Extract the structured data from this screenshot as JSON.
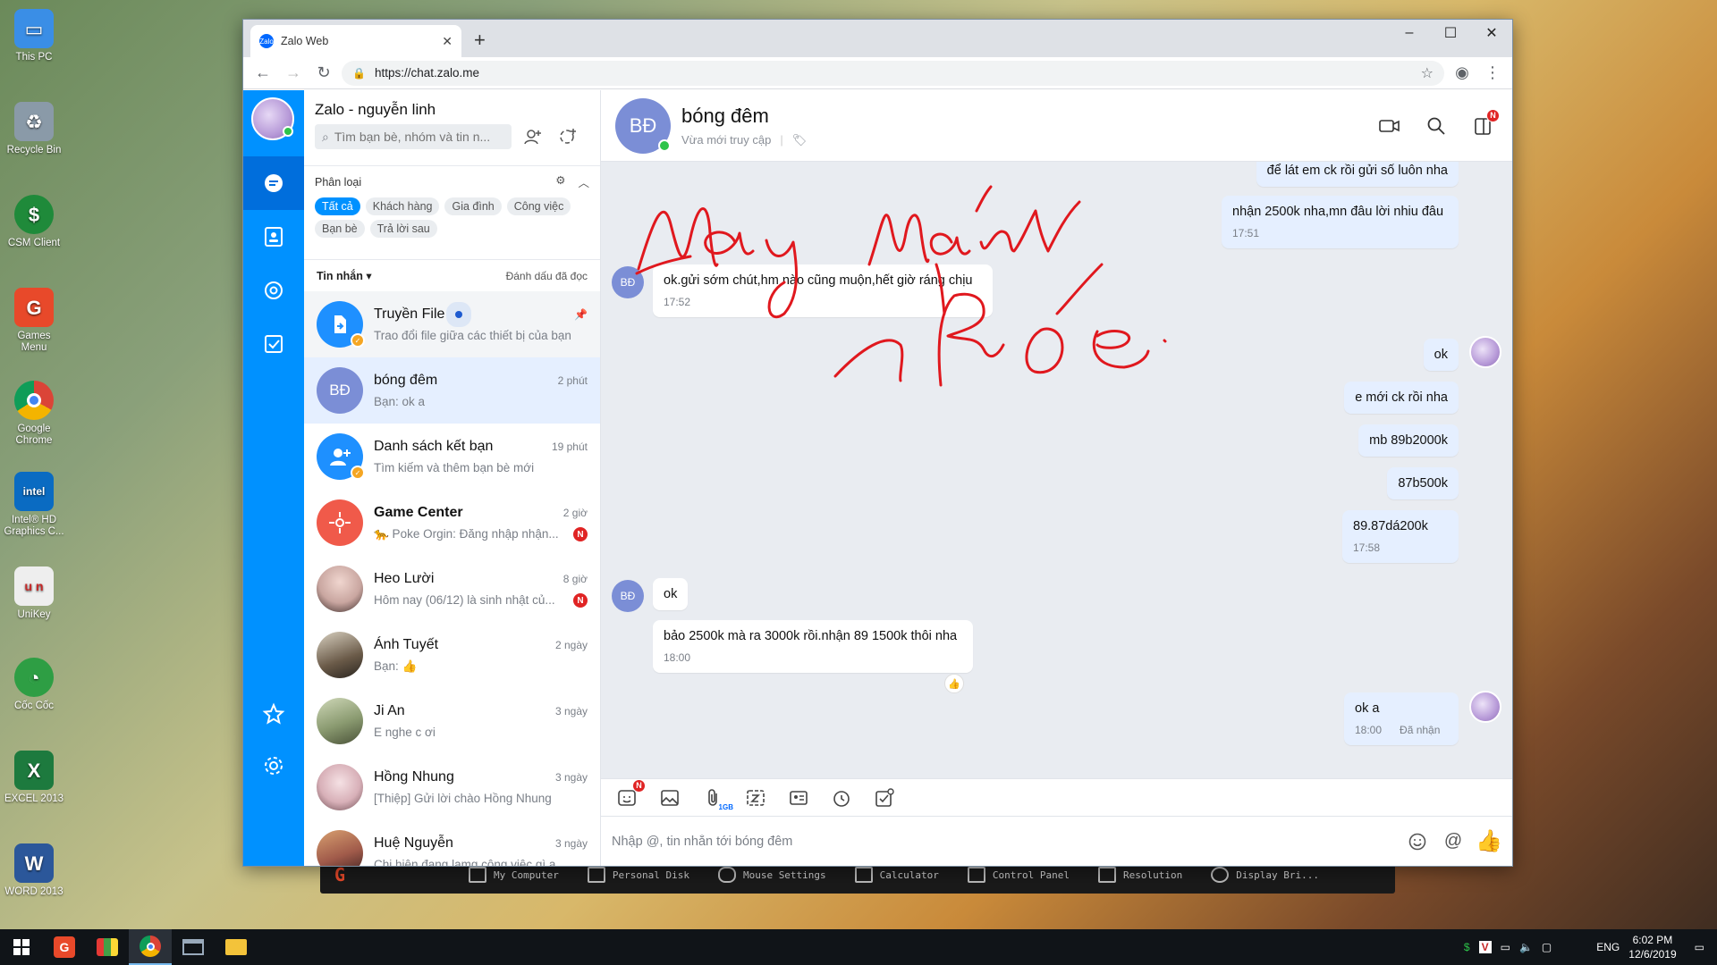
{
  "desktop": {
    "icons": [
      {
        "label": "This PC",
        "icon": "computer-icon",
        "color": "#3a8ee6"
      },
      {
        "label": "Recycle Bin",
        "icon": "recycle-bin-icon",
        "color": "#8a9aa8"
      },
      {
        "label": "CSM Client",
        "icon": "dollar-icon",
        "color": "#1f8a3a"
      },
      {
        "label": "Games Menu",
        "icon": "g-logo-icon",
        "color": "#e8492a"
      },
      {
        "label": "Google Chrome",
        "icon": "chrome-icon",
        "color": "#db4437"
      },
      {
        "label": "Intel® HD Graphics C...",
        "icon": "intel-icon",
        "color": "#0a6bc2"
      },
      {
        "label": "UniKey",
        "icon": "unikey-icon",
        "color": "#c62828"
      },
      {
        "label": "Cốc Cốc",
        "icon": "coccoc-icon",
        "color": "#2e9e44"
      },
      {
        "label": "EXCEL 2013",
        "icon": "excel-icon",
        "color": "#1d7a3e"
      },
      {
        "label": "WORD 2013",
        "icon": "word-icon",
        "color": "#2b579a"
      }
    ]
  },
  "launcher": {
    "items": [
      "My Computer",
      "Personal Disk",
      "Mouse Settings",
      "Calculator",
      "Control Panel",
      "Resolution",
      "Display Bri..."
    ]
  },
  "taskbar": {
    "lang": "ENG",
    "time": "6:02 PM",
    "date": "12/6/2019"
  },
  "browser": {
    "tab_title": "Zalo Web",
    "url": "https://chat.zalo.me"
  },
  "sidebar": {
    "title": "Zalo - nguyễn linh",
    "search_placeholder": "Tìm bạn bè, nhóm và tin n...",
    "category_label": "Phân loại",
    "chips": [
      "Tất cả",
      "Khách hàng",
      "Gia đình",
      "Công việc",
      "Bạn bè",
      "Trả lời sau"
    ],
    "messages_label": "Tin nhắn",
    "mark_read": "Đánh dấu đã đọc",
    "conversations": [
      {
        "name": "Truyền File",
        "preview": "Trao đổi file giữa các thiết bị của bạn",
        "time": "",
        "avatar_text": "",
        "avatar_color": "#1e90ff",
        "badge": "",
        "bold": false
      },
      {
        "name": "bóng đêm",
        "preview": "Bạn: ok a",
        "time": "2 phút",
        "avatar_text": "BĐ",
        "avatar_color": "#7b8ed6",
        "badge": "",
        "bold": false
      },
      {
        "name": "Danh sách kết bạn",
        "preview": "Tìm kiếm và thêm bạn bè mới",
        "time": "19 phút",
        "avatar_text": "",
        "avatar_color": "#1e90ff",
        "badge": "",
        "bold": false
      },
      {
        "name": "Game Center",
        "preview": "🐆 Poke Orgin: Đăng nhập nhận...",
        "time": "2 giờ",
        "avatar_text": "",
        "avatar_color": "#f05a4a",
        "badge": "N",
        "bold": true
      },
      {
        "name": "Heo Lười",
        "preview": "Hôm nay (06/12) là sinh nhật củ...",
        "time": "8 giờ",
        "avatar_text": "",
        "avatar_color": "#c9a6a0",
        "badge": "N",
        "bold": false
      },
      {
        "name": "Ánh Tuyết",
        "preview": "Bạn: 👍",
        "time": "2 ngày",
        "avatar_text": "",
        "avatar_color": "#6a5a48",
        "badge": "",
        "bold": false
      },
      {
        "name": "Ji An",
        "preview": "E nghe c ơi",
        "time": "3 ngày",
        "avatar_text": "",
        "avatar_color": "#8a9a70",
        "badge": "",
        "bold": false
      },
      {
        "name": "Hồng Nhung",
        "preview": "[Thiệp] Gửi lời chào Hồng Nhung",
        "time": "3 ngày",
        "avatar_text": "",
        "avatar_color": "#d8b0b8",
        "badge": "",
        "bold": false
      },
      {
        "name": "Huệ Nguyễn",
        "preview": "Chị hiện đang lamg công việc gì a",
        "time": "3 ngày",
        "avatar_text": "",
        "avatar_color": "#a05a4a",
        "badge": "",
        "bold": false
      }
    ]
  },
  "chat": {
    "name": "bóng đêm",
    "avatar_text": "BĐ",
    "status": "Vừa mới truy cập",
    "composer_placeholder": "Nhập @, tin nhắn tới bóng đêm",
    "messages": [
      {
        "text": "để lát em ck rồi gửi số luôn nha",
        "time": "",
        "status": ""
      },
      {
        "text": "nhận 2500k nha,mn đâu lời nhiu đâu",
        "time": "17:51",
        "status": ""
      },
      {
        "text": "ok.gửi sớm chút,hm nào cũng muộn,hết giờ ráng chịu",
        "time": "17:52",
        "status": ""
      },
      {
        "text": "ok",
        "time": "",
        "status": ""
      },
      {
        "text": "e mới ck rồi nha",
        "time": "",
        "status": ""
      },
      {
        "text": "mb 89b2000k",
        "time": "",
        "status": ""
      },
      {
        "text": "87b500k",
        "time": "",
        "status": ""
      },
      {
        "text": "89.87dá200k",
        "time": "17:58",
        "status": ""
      },
      {
        "text": "ok",
        "time": "",
        "status": ""
      },
      {
        "text": "bảo 2500k mà ra 3000k rồi.nhận 89 1500k thôi nha",
        "time": "18:00",
        "status": ""
      },
      {
        "text": "ok a",
        "time": "18:00",
        "status": "Đã nhận"
      }
    ]
  },
  "colors": {
    "rail": "#0091ff",
    "rail_active": "#006edc",
    "accent": "#0091ff",
    "ink": "#e0181e"
  }
}
